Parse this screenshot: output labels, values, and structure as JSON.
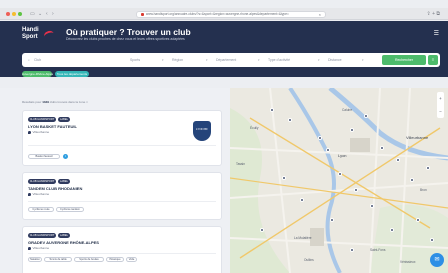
{
  "browser": {
    "url": "www.handisport.org/annuaire-clubs/?s=&sport=&region=auvergne-rhone-alpes&departement=&type=",
    "tab_close": "×"
  },
  "header": {
    "logo_line1": "Handi",
    "logo_line2": "Sport",
    "title": "Où pratiquer ? Trouver un club",
    "subtitle": "Découvrez les clubs proches de chez vous et leurs offres sportives adaptées",
    "menu_icon": "menu-icon"
  },
  "search": {
    "field_main": "Club",
    "field_sport": "Sports",
    "field_region": "Région",
    "field_department": "Département",
    "field_type": "Type d'activité",
    "field_distance": "Distance",
    "submit_label": "Rechercher",
    "options_icon": "≡"
  },
  "filters": {
    "chip1": "Auvergne-Rhône-Alpes",
    "chip2": "Tous les départements"
  },
  "breadcrumb": {
    "prefix": "Résultats pour",
    "count": "1349",
    "suffix": "clubs trouvés dans la zone",
    "icon": "×"
  },
  "clubs": [
    {
      "badge1": "CLUB HANDISPORT",
      "badge2": "LABEL",
      "name": "LYON BASKET FAUTEUIL",
      "location": "Villeurbanne",
      "tag": "Basket fauteuil",
      "logo_text": "LYON BF"
    },
    {
      "badge1": "CLUB HANDISPORT",
      "badge2": "LABEL",
      "name": "TANDEM CLUB RHODANIEN",
      "location": "Villeurbanne",
      "tag1": "Cyclisme route",
      "tag2": "Cyclisme tandem"
    },
    {
      "badge1": "CLUB HANDISPORT",
      "badge2": "LABEL",
      "name": "GRADEV AUVERGNE RHÔNE-ALPES",
      "location": "Villeurbanne",
      "tag1": "Natation",
      "tag2": "Tennis de table",
      "tag3": "Sports de boules",
      "tag4": "Pétanque",
      "tag5": "Voile"
    }
  ],
  "map": {
    "label_villeurbanne": "Villeurbanne",
    "label_ecully": "Écully",
    "label_lyon": "Lyon",
    "label_bron": "Bron",
    "label_mulatiere": "La Mulatière",
    "label_oullins": "Oullins",
    "label_stfons": "Saint-Fons",
    "label_venissieux": "Vénissieux",
    "label_tassin": "Tassin",
    "label_caluire": "Caluire",
    "zoom_in": "+",
    "zoom_out": "−",
    "chat_icon": "chat-icon"
  },
  "colors": {
    "header_bg": "#24304f",
    "accent_green": "#4dbb6b",
    "badge_navy": "#2f3a5e",
    "chip_teal": "#34b6b7",
    "chip_green": "#4dbb6b"
  }
}
